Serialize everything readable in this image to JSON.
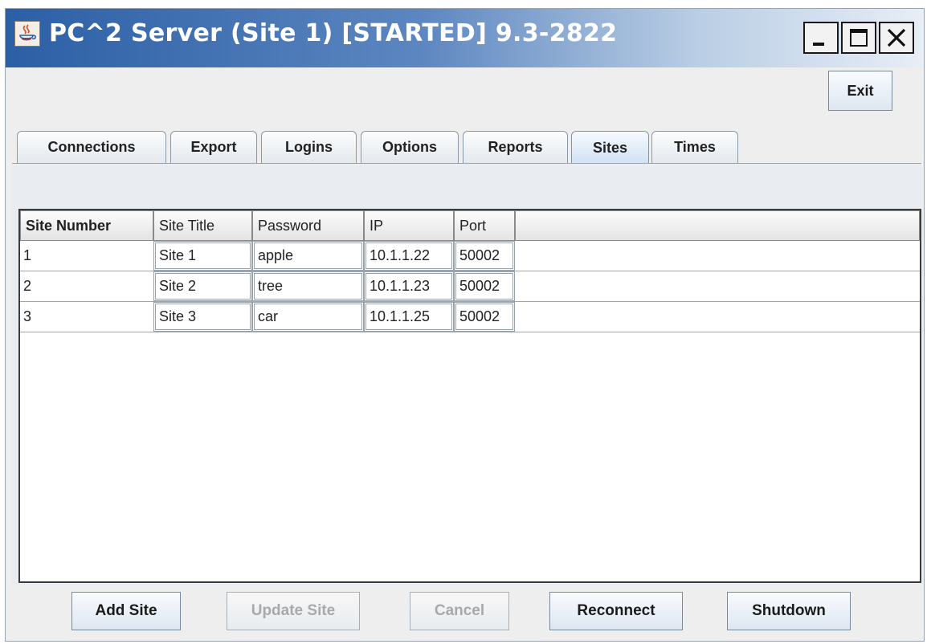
{
  "window": {
    "title": "PC^2 Server (Site 1) [STARTED] 9.3-2822",
    "icon": "java-coffee-cup-icon",
    "controls": {
      "minimize": "minimize-icon",
      "maximize": "maximize-icon",
      "close": "close-icon"
    }
  },
  "toolbar": {
    "exit_label": "Exit"
  },
  "tabs": [
    {
      "label": "Connections"
    },
    {
      "label": "Export"
    },
    {
      "label": "Logins"
    },
    {
      "label": "Options"
    },
    {
      "label": "Reports"
    },
    {
      "label": "Sites",
      "active": true
    },
    {
      "label": "Times"
    }
  ],
  "table": {
    "headers": [
      "Site Number",
      "Site Title",
      "Password",
      "IP",
      "Port",
      ""
    ],
    "rows": [
      [
        "1",
        "Site 1",
        "apple",
        "10.1.1.22",
        "50002"
      ],
      [
        "2",
        "Site 2",
        "tree",
        "10.1.1.23",
        "50002"
      ],
      [
        "3",
        "Site 3",
        "car",
        "10.1.1.25",
        "50002"
      ]
    ]
  },
  "buttons": {
    "add_site": "Add Site",
    "update_site": "Update Site",
    "cancel": "Cancel",
    "reconnect": "Reconnect",
    "shutdown": "Shutdown"
  },
  "colors": {
    "titlebar_start": "#2b5fa5",
    "titlebar_end": "#e7eef6",
    "active_tab": "#cfe0f2",
    "disabled_text": "#a9a9a9"
  }
}
